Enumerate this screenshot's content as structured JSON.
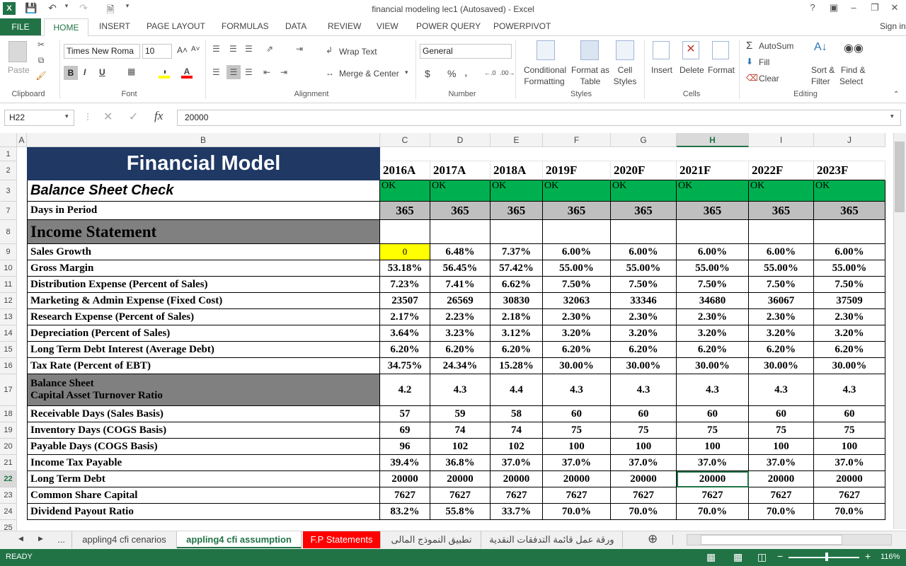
{
  "window": {
    "title": "financial modeling lec1 (Autosaved) - Excel",
    "help": "?",
    "sign_in": "Sign in"
  },
  "ribbon_tabs": [
    "FILE",
    "HOME",
    "INSERT",
    "PAGE LAYOUT",
    "FORMULAS",
    "DATA",
    "REVIEW",
    "VIEW",
    "POWER QUERY",
    "POWERPIVOT"
  ],
  "ribbon": {
    "paste": "Paste",
    "font_name": "Times New Roma",
    "font_size": "10",
    "wrap_text": "Wrap Text",
    "merge_center": "Merge & Center",
    "number_format": "General",
    "conditional_formatting": [
      "Conditional",
      "Formatting"
    ],
    "format_as_table": [
      "Format as",
      "Table"
    ],
    "cell_styles": [
      "Cell",
      "Styles"
    ],
    "insert": "Insert",
    "delete": "Delete",
    "format": "Format",
    "autosum": "AutoSum",
    "fill": "Fill",
    "clear": "Clear",
    "sort_filter": [
      "Sort &",
      "Filter"
    ],
    "find_select": [
      "Find &",
      "Select"
    ],
    "groups": [
      "Clipboard",
      "Font",
      "Alignment",
      "Number",
      "Styles",
      "Cells",
      "Editing"
    ],
    "bold": "B",
    "italic": "I",
    "underline": "U",
    "currency": "$",
    "percent": "%",
    "comma": ","
  },
  "formula_bar": {
    "name_box": "H22",
    "formula": "20000",
    "fx": "fx"
  },
  "columns": [
    "A",
    "B",
    "C",
    "D",
    "E",
    "F",
    "G",
    "H",
    "I",
    "J"
  ],
  "sheet": {
    "title": "Financial Model",
    "years": [
      "2016A",
      "2017A",
      "2018A",
      "2019F",
      "2020F",
      "2021F",
      "2022F",
      "2023F"
    ],
    "balance_check_label": "Balance Sheet Check",
    "balance_check_values": [
      "OK",
      "OK",
      "OK",
      "OK",
      "OK",
      "OK",
      "OK",
      "OK"
    ],
    "days_label": "Days in Period",
    "days_values": [
      "365",
      "365",
      "365",
      "365",
      "365",
      "365",
      "365",
      "365"
    ],
    "income_statement": "Income Statement",
    "rows": [
      {
        "row": "9",
        "label": "Sales Growth",
        "values": [
          "0",
          "6.48%",
          "7.37%",
          "6.00%",
          "6.00%",
          "6.00%",
          "6.00%",
          "6.00%"
        ]
      },
      {
        "row": "10",
        "label": "Gross Margin",
        "values": [
          "53.18%",
          "56.45%",
          "57.42%",
          "55.00%",
          "55.00%",
          "55.00%",
          "55.00%",
          "55.00%"
        ]
      },
      {
        "row": "11",
        "label": "Distribution Expense (Percent of Sales)",
        "values": [
          "7.23%",
          "7.41%",
          "6.62%",
          "7.50%",
          "7.50%",
          "7.50%",
          "7.50%",
          "7.50%"
        ]
      },
      {
        "row": "12",
        "label": "Marketing & Admin Expense (Fixed Cost)",
        "values": [
          "23507",
          "26569",
          "30830",
          "32063",
          "33346",
          "34680",
          "36067",
          "37509"
        ]
      },
      {
        "row": "13",
        "label": "Research Expense (Percent of Sales)",
        "values": [
          "2.17%",
          "2.23%",
          "2.18%",
          "2.30%",
          "2.30%",
          "2.30%",
          "2.30%",
          "2.30%"
        ]
      },
      {
        "row": "14",
        "label": "Depreciation (Percent of Sales)",
        "values": [
          "3.64%",
          "3.23%",
          "3.12%",
          "3.20%",
          "3.20%",
          "3.20%",
          "3.20%",
          "3.20%"
        ]
      },
      {
        "row": "15",
        "label": "Long Term Debt Interest (Average Debt)",
        "values": [
          "6.20%",
          "6.20%",
          "6.20%",
          "6.20%",
          "6.20%",
          "6.20%",
          "6.20%",
          "6.20%"
        ]
      },
      {
        "row": "16",
        "label": "Tax Rate (Percent of EBT)",
        "values": [
          "34.75%",
          "24.34%",
          "15.28%",
          "30.00%",
          "30.00%",
          "30.00%",
          "30.00%",
          "30.00%"
        ]
      }
    ],
    "balance_sheet_heading": "Balance Sheet",
    "capital_asset_label": "Capital Asset Turnover Ratio",
    "capital_asset_values": [
      "4.2",
      "4.3",
      "4.4",
      "4.3",
      "4.3",
      "4.3",
      "4.3",
      "4.3"
    ],
    "rows2": [
      {
        "row": "18",
        "label": "Receivable Days (Sales Basis)",
        "values": [
          "57",
          "59",
          "58",
          "60",
          "60",
          "60",
          "60",
          "60"
        ]
      },
      {
        "row": "19",
        "label": "Inventory Days (COGS Basis)",
        "values": [
          "69",
          "74",
          "74",
          "75",
          "75",
          "75",
          "75",
          "75"
        ]
      },
      {
        "row": "20",
        "label": "Payable Days (COGS Basis)",
        "values": [
          "96",
          "102",
          "102",
          "100",
          "100",
          "100",
          "100",
          "100"
        ]
      },
      {
        "row": "21",
        "label": "Income Tax Payable",
        "values": [
          "39.4%",
          "36.8%",
          "37.0%",
          "37.0%",
          "37.0%",
          "37.0%",
          "37.0%",
          "37.0%"
        ]
      },
      {
        "row": "22",
        "label": "Long Term Debt",
        "values": [
          "20000",
          "20000",
          "20000",
          "20000",
          "20000",
          "20000",
          "20000",
          "20000"
        ]
      },
      {
        "row": "23",
        "label": "Common Share Capital",
        "values": [
          "7627",
          "7627",
          "7627",
          "7627",
          "7627",
          "7627",
          "7627",
          "7627"
        ]
      },
      {
        "row": "24",
        "label": "Dividend Payout Ratio",
        "values": [
          "83.2%",
          "55.8%",
          "33.7%",
          "70.0%",
          "70.0%",
          "70.0%",
          "70.0%",
          "70.0%"
        ]
      }
    ],
    "row_numbers_top": [
      "1",
      "2",
      "3",
      "7",
      "8"
    ],
    "row_17": "17",
    "row_25": "25"
  },
  "sheet_tabs": {
    "more": "...",
    "tabs": [
      "appling4 cfi cenarios",
      "appling4 cfi assumption",
      "F.P Statements",
      "تطبيق النموذج المالى",
      "ورقة عمل قائمة التدفقات النقدية"
    ]
  },
  "status": {
    "ready": "READY",
    "zoom": "116%"
  },
  "colors": {
    "excel_green": "#217346",
    "title_fill": "#1f3864",
    "ok_fill": "#00b050",
    "header_gray": "#bfbfbf",
    "section_gray": "#808080",
    "highlight": "#ffff00",
    "red_tab": "#ff0000"
  }
}
